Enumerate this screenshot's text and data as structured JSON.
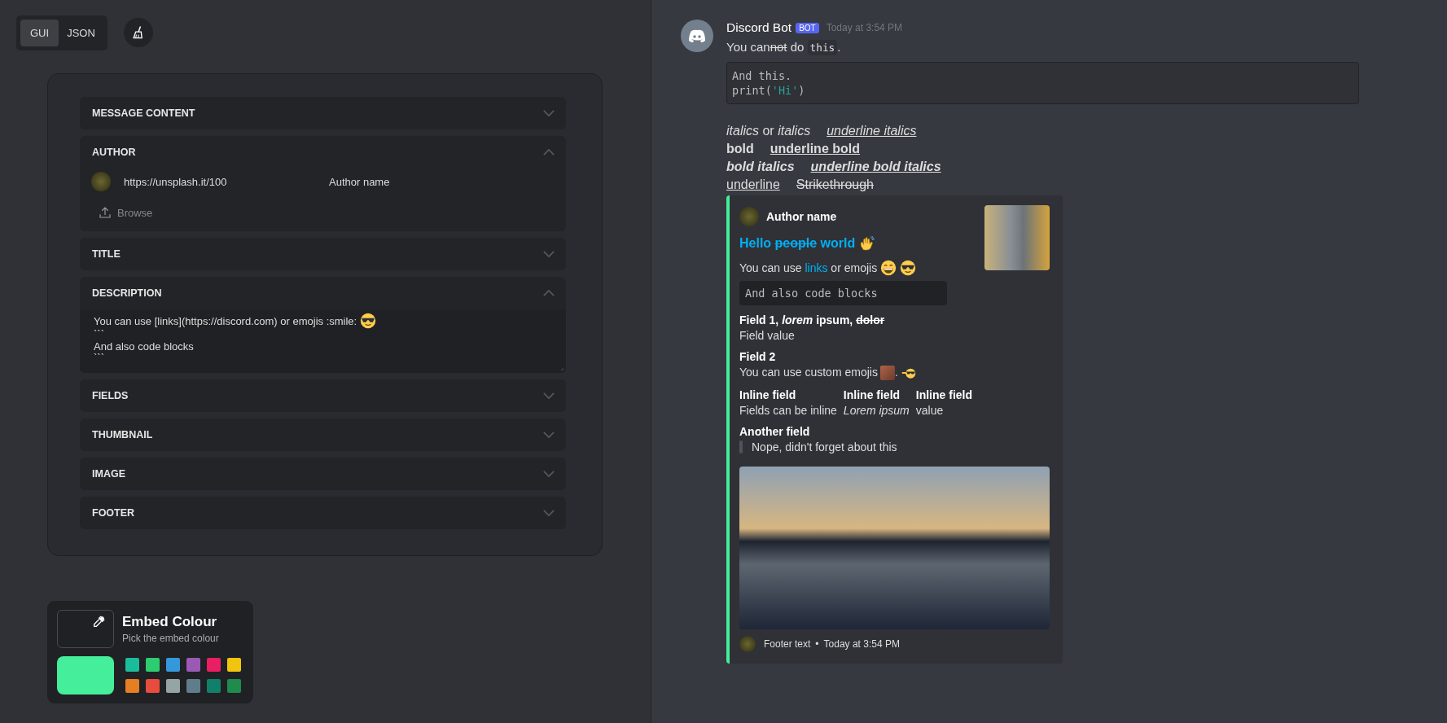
{
  "mode_switch": [
    {
      "label": "GUI",
      "selected": true
    },
    {
      "label": "JSON",
      "selected": false
    }
  ],
  "editor": {
    "sections": [
      {
        "title": "MESSAGE CONTENT",
        "expanded": false
      },
      {
        "title": "AUTHOR",
        "expanded": true,
        "kind": "author",
        "icon_url": "https://unsplash.it/100",
        "name": "Author name",
        "browse": "Browse"
      },
      {
        "title": "TITLE",
        "expanded": false
      },
      {
        "title": "DESCRIPTION",
        "expanded": true,
        "kind": "text",
        "lines": [
          [
            {
              "text": "You can use [links](https://discord.com) or emojis :smile:",
              "kind": "plain"
            },
            {
              "kind": "emoji"
            }
          ],
          [
            {
              "text": "```",
              "kind": "plain"
            }
          ],
          [
            {
              "text": "And also code blocks",
              "kind": "plain"
            }
          ],
          [
            {
              "text": "```",
              "kind": "plain"
            }
          ]
        ]
      },
      {
        "title": "FIELDS",
        "expanded": false
      },
      {
        "title": "THUMBNAIL",
        "expanded": false
      },
      {
        "title": "IMAGE",
        "expanded": false
      },
      {
        "title": "FOOTER",
        "expanded": false
      }
    ]
  },
  "embed_colour": {
    "title": "Embed Colour",
    "subtitle": "Pick the embed colour",
    "color": "#45ee9a",
    "swatches": [
      {
        "color": "#1abc9c"
      },
      {
        "color": "#2ecc71"
      },
      {
        "color": "#3498db"
      },
      {
        "color": "#9b59b6"
      },
      {
        "color": "#e91e63"
      },
      {
        "color": "#f1c40f"
      },
      {
        "color": "#e67e22"
      },
      {
        "color": "#e74c3c"
      },
      {
        "color": "#95a5a6"
      },
      {
        "color": "#607d8b"
      },
      {
        "color": "#11806a"
      },
      {
        "color": "#1f8b4c"
      }
    ]
  },
  "message": {
    "author": "Discord Bot",
    "badge": "BOT",
    "timestamp": "Today at 3:54 PM",
    "content": [
      {
        "text": "You can",
        "kind": "plain"
      },
      {
        "text": "not",
        "kind": "strike"
      },
      {
        "text": " do ",
        "kind": "plain"
      },
      {
        "text": "this",
        "kind": "code"
      },
      {
        "text": ".",
        "kind": "plain"
      }
    ],
    "code_block": [
      [
        {
          "text": "And this.",
          "kind": "plain"
        }
      ],
      [
        {
          "text": "print(",
          "kind": "plain"
        },
        {
          "text": "'Hi'",
          "kind": "string"
        },
        {
          "text": ")",
          "kind": "plain"
        }
      ]
    ],
    "markdown_lines": [
      [
        {
          "text": "italics",
          "kind": "italic"
        },
        {
          "text": " or ",
          "kind": "plain"
        },
        {
          "text": "italics",
          "kind": "italic"
        },
        {
          "text": "underline italics",
          "kind": "underlineitalic",
          "gap_before": true
        }
      ],
      [
        {
          "text": "bold",
          "kind": "bold"
        },
        {
          "text": "underline bold",
          "kind": "underlinebold",
          "gap_before": true
        }
      ],
      [
        {
          "text": "bold italics",
          "kind": "bolditalic"
        },
        {
          "text": "underline bold italics",
          "kind": "underlinebolditalic",
          "gap_before": true
        }
      ],
      [
        {
          "text": "underline",
          "kind": "underline"
        },
        {
          "text": "Strikethrough",
          "kind": "strike",
          "gap_before": true
        }
      ]
    ],
    "embed": {
      "color": "#45ee9a",
      "author": "Author name",
      "title": [
        {
          "text": "Hello ",
          "kind": "plain"
        },
        {
          "text": "people",
          "kind": "strike"
        },
        {
          "text": " world",
          "kind": "plain"
        },
        {
          "kind": "emoji"
        }
      ],
      "description": [
        {
          "text": "You can use ",
          "kind": "plain"
        },
        {
          "text": "links",
          "kind": "link"
        },
        {
          "text": " or emojis",
          "kind": "plain"
        },
        {
          "kind": "emoji"
        },
        {
          "kind": "emoji"
        }
      ],
      "code_block": "And also code blocks",
      "fields": [
        {
          "kind": "plain",
          "inline": false,
          "name": [
            {
              "text": "Field 1, ",
              "kind": "plain"
            },
            {
              "text": "lorem",
              "kind": "italic"
            },
            {
              "text": " ipsum, ",
              "kind": "plain"
            },
            {
              "text": "dolor",
              "kind": "strike"
            }
          ],
          "value": [
            {
              "text": "Field value",
              "kind": "plain"
            }
          ]
        },
        {
          "kind": "plain",
          "inline": false,
          "name": [
            {
              "text": "Field 2",
              "kind": "plain"
            }
          ],
          "value": [
            {
              "text": "You can use custom emojis",
              "kind": "plain"
            },
            {
              "kind": "emoji"
            },
            {
              "text": ".",
              "kind": "plain"
            },
            {
              "kind": "emoji"
            }
          ]
        },
        {
          "kind": "plain",
          "inline": true,
          "name": [
            {
              "text": "Inline field",
              "kind": "plain"
            }
          ],
          "value": [
            {
              "text": "Fields can be inline",
              "kind": "plain"
            }
          ]
        },
        {
          "kind": "plain",
          "inline": true,
          "name": [
            {
              "text": "Inline field",
              "kind": "plain"
            }
          ],
          "value": [
            {
              "text": "Lorem ipsum",
              "kind": "italic"
            }
          ]
        },
        {
          "kind": "plain",
          "inline": true,
          "name": [
            {
              "text": "Inline field",
              "kind": "plain"
            }
          ],
          "value": [
            {
              "text": "value",
              "kind": "plain"
            }
          ]
        },
        {
          "kind": "quote",
          "inline": false,
          "name": [
            {
              "text": "Another field",
              "kind": "plain"
            }
          ],
          "value": [
            {
              "text": "Nope, didn't forget about this",
              "kind": "plain"
            }
          ]
        }
      ],
      "footer": {
        "text": "Footer text",
        "separator": "•",
        "timestamp": "Today at 3:54 PM"
      }
    }
  }
}
